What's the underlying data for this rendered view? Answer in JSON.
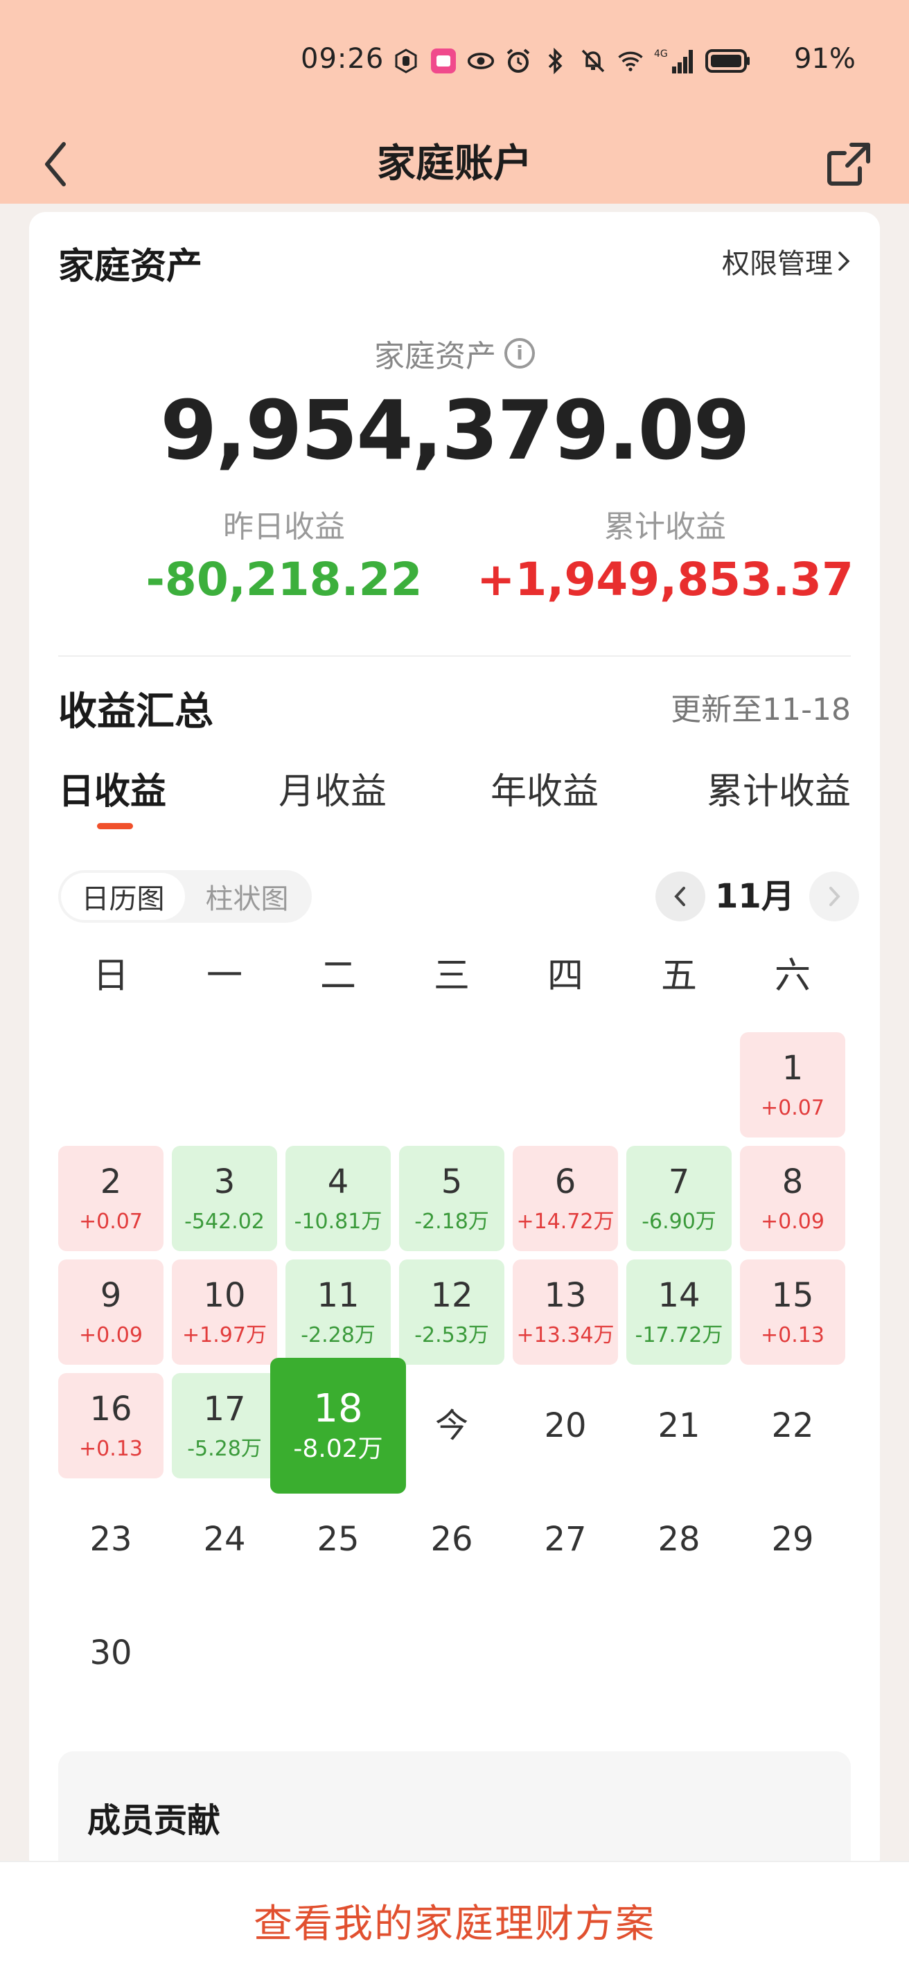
{
  "status_bar": {
    "time": "09:26",
    "battery": "91%",
    "icons": [
      "hand-icon",
      "app-badge-icon",
      "eye-icon",
      "alarm-icon",
      "bluetooth-icon",
      "mute-icon",
      "wifi-icon",
      "signal-4g-icon",
      "battery-icon"
    ]
  },
  "nav": {
    "title": "家庭账户",
    "back_icon": "chevron-left-icon",
    "share_icon": "share-icon"
  },
  "assets": {
    "section_title": "家庭资产",
    "permission_link": "权限管理",
    "label": "家庭资产",
    "value": "9,954,379.09",
    "yesterday_label": "昨日收益",
    "yesterday_value": "-80,218.22",
    "total_label": "累计收益",
    "total_value": "+1,949,853.37"
  },
  "summary": {
    "title": "收益汇总",
    "update_text": "更新至11-18",
    "tabs": [
      "日收益",
      "月收益",
      "年收益",
      "累计收益"
    ],
    "active_tab": 0,
    "view_toggle": [
      "日历图",
      "柱状图"
    ],
    "active_view": 0,
    "month": "11月"
  },
  "calendar": {
    "weekdays": [
      "日",
      "一",
      "二",
      "三",
      "四",
      "五",
      "六"
    ],
    "days": [
      {
        "d": "1",
        "v": "+0.07",
        "type": "pos"
      },
      {
        "d": "2",
        "v": "+0.07",
        "type": "pos"
      },
      {
        "d": "3",
        "v": "-542.02",
        "type": "neg"
      },
      {
        "d": "4",
        "v": "-10.81万",
        "type": "neg"
      },
      {
        "d": "5",
        "v": "-2.18万",
        "type": "neg"
      },
      {
        "d": "6",
        "v": "+14.72万",
        "type": "pos"
      },
      {
        "d": "7",
        "v": "-6.90万",
        "type": "neg"
      },
      {
        "d": "8",
        "v": "+0.09",
        "type": "pos"
      },
      {
        "d": "9",
        "v": "+0.09",
        "type": "pos"
      },
      {
        "d": "10",
        "v": "+1.97万",
        "type": "pos"
      },
      {
        "d": "11",
        "v": "-2.28万",
        "type": "neg"
      },
      {
        "d": "12",
        "v": "-2.53万",
        "type": "neg"
      },
      {
        "d": "13",
        "v": "+13.34万",
        "type": "pos"
      },
      {
        "d": "14",
        "v": "-17.72万",
        "type": "neg"
      },
      {
        "d": "15",
        "v": "+0.13",
        "type": "pos"
      },
      {
        "d": "16",
        "v": "+0.13",
        "type": "pos"
      },
      {
        "d": "17",
        "v": "-5.28万",
        "type": "neg"
      },
      {
        "d": "18",
        "v": "-8.02万",
        "type": "sel"
      },
      {
        "d": "今",
        "v": "",
        "type": "plain"
      },
      {
        "d": "20",
        "v": "",
        "type": "plain"
      },
      {
        "d": "21",
        "v": "",
        "type": "plain"
      },
      {
        "d": "22",
        "v": "",
        "type": "plain"
      },
      {
        "d": "23",
        "v": "",
        "type": "plain"
      },
      {
        "d": "24",
        "v": "",
        "type": "plain"
      },
      {
        "d": "25",
        "v": "",
        "type": "plain"
      },
      {
        "d": "26",
        "v": "",
        "type": "plain"
      },
      {
        "d": "27",
        "v": "",
        "type": "plain"
      },
      {
        "d": "28",
        "v": "",
        "type": "plain"
      },
      {
        "d": "29",
        "v": "",
        "type": "plain"
      },
      {
        "d": "30",
        "v": "",
        "type": "plain"
      }
    ],
    "first_weekday_index": 6
  },
  "members": {
    "title": "成员贡献"
  },
  "bottom": {
    "cta": "查看我的家庭理财方案"
  },
  "colors": {
    "header_bg": "#fccab4",
    "accent": "#f0502b",
    "gain": "#e82e2e",
    "loss": "#3caf3c",
    "selected": "#3aae2f"
  }
}
